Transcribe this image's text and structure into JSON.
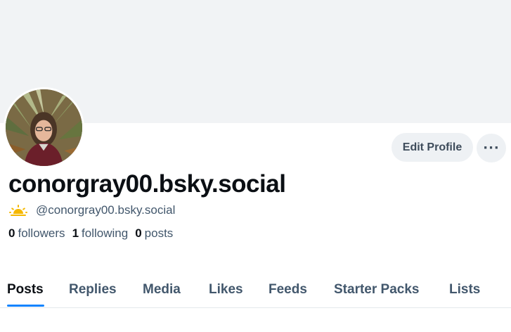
{
  "profile": {
    "display_name": "conorgray00.bsky.social",
    "handle": "@conorgray00.bsky.social",
    "handle_icon": "sun-icon"
  },
  "actions": {
    "edit_profile_label": "Edit Profile",
    "more_label": "···"
  },
  "stats": {
    "followers_count": "0",
    "followers_label": "followers",
    "following_count": "1",
    "following_label": "following",
    "posts_count": "0",
    "posts_label": "posts"
  },
  "tabs": [
    {
      "label": "Posts",
      "active": true
    },
    {
      "label": "Replies",
      "active": false
    },
    {
      "label": "Media",
      "active": false
    },
    {
      "label": "Likes",
      "active": false
    },
    {
      "label": "Feeds",
      "active": false
    },
    {
      "label": "Starter Packs",
      "active": false
    },
    {
      "label": "Lists",
      "active": false
    }
  ],
  "colors": {
    "accent": "#1083fe",
    "banner": "#f1f3f5",
    "secondary_text": "#42576c",
    "button_bg": "#eef1f4"
  }
}
